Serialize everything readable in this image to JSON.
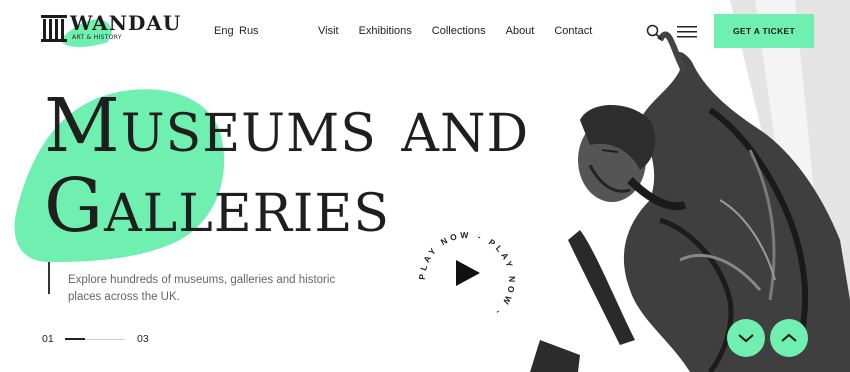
{
  "brand": {
    "name": "WANDAU",
    "tagline": "ART & HISTORY"
  },
  "languages": [
    "Eng",
    "Rus"
  ],
  "nav": [
    "Visit",
    "Exhibitions",
    "Collections",
    "About",
    "Contact"
  ],
  "cta": {
    "label": "GET A TICKET"
  },
  "hero": {
    "title_line1": "Museums and",
    "title_line2": "Galleries",
    "description": "Explore hundreds of museums, galleries and historic places across the UK."
  },
  "pager": {
    "current": "01",
    "total": "03",
    "progress": 0.33
  },
  "play": {
    "label": "PLAY NOW - PLAY NOW - "
  },
  "icons": [
    "logo-columns-icon",
    "search-icon",
    "menu-icon",
    "play-icon",
    "chevron-down-icon",
    "chevron-up-icon"
  ],
  "colors": {
    "accent": "#6ff0b0",
    "text": "#1f1f1f",
    "muted": "#666666"
  }
}
